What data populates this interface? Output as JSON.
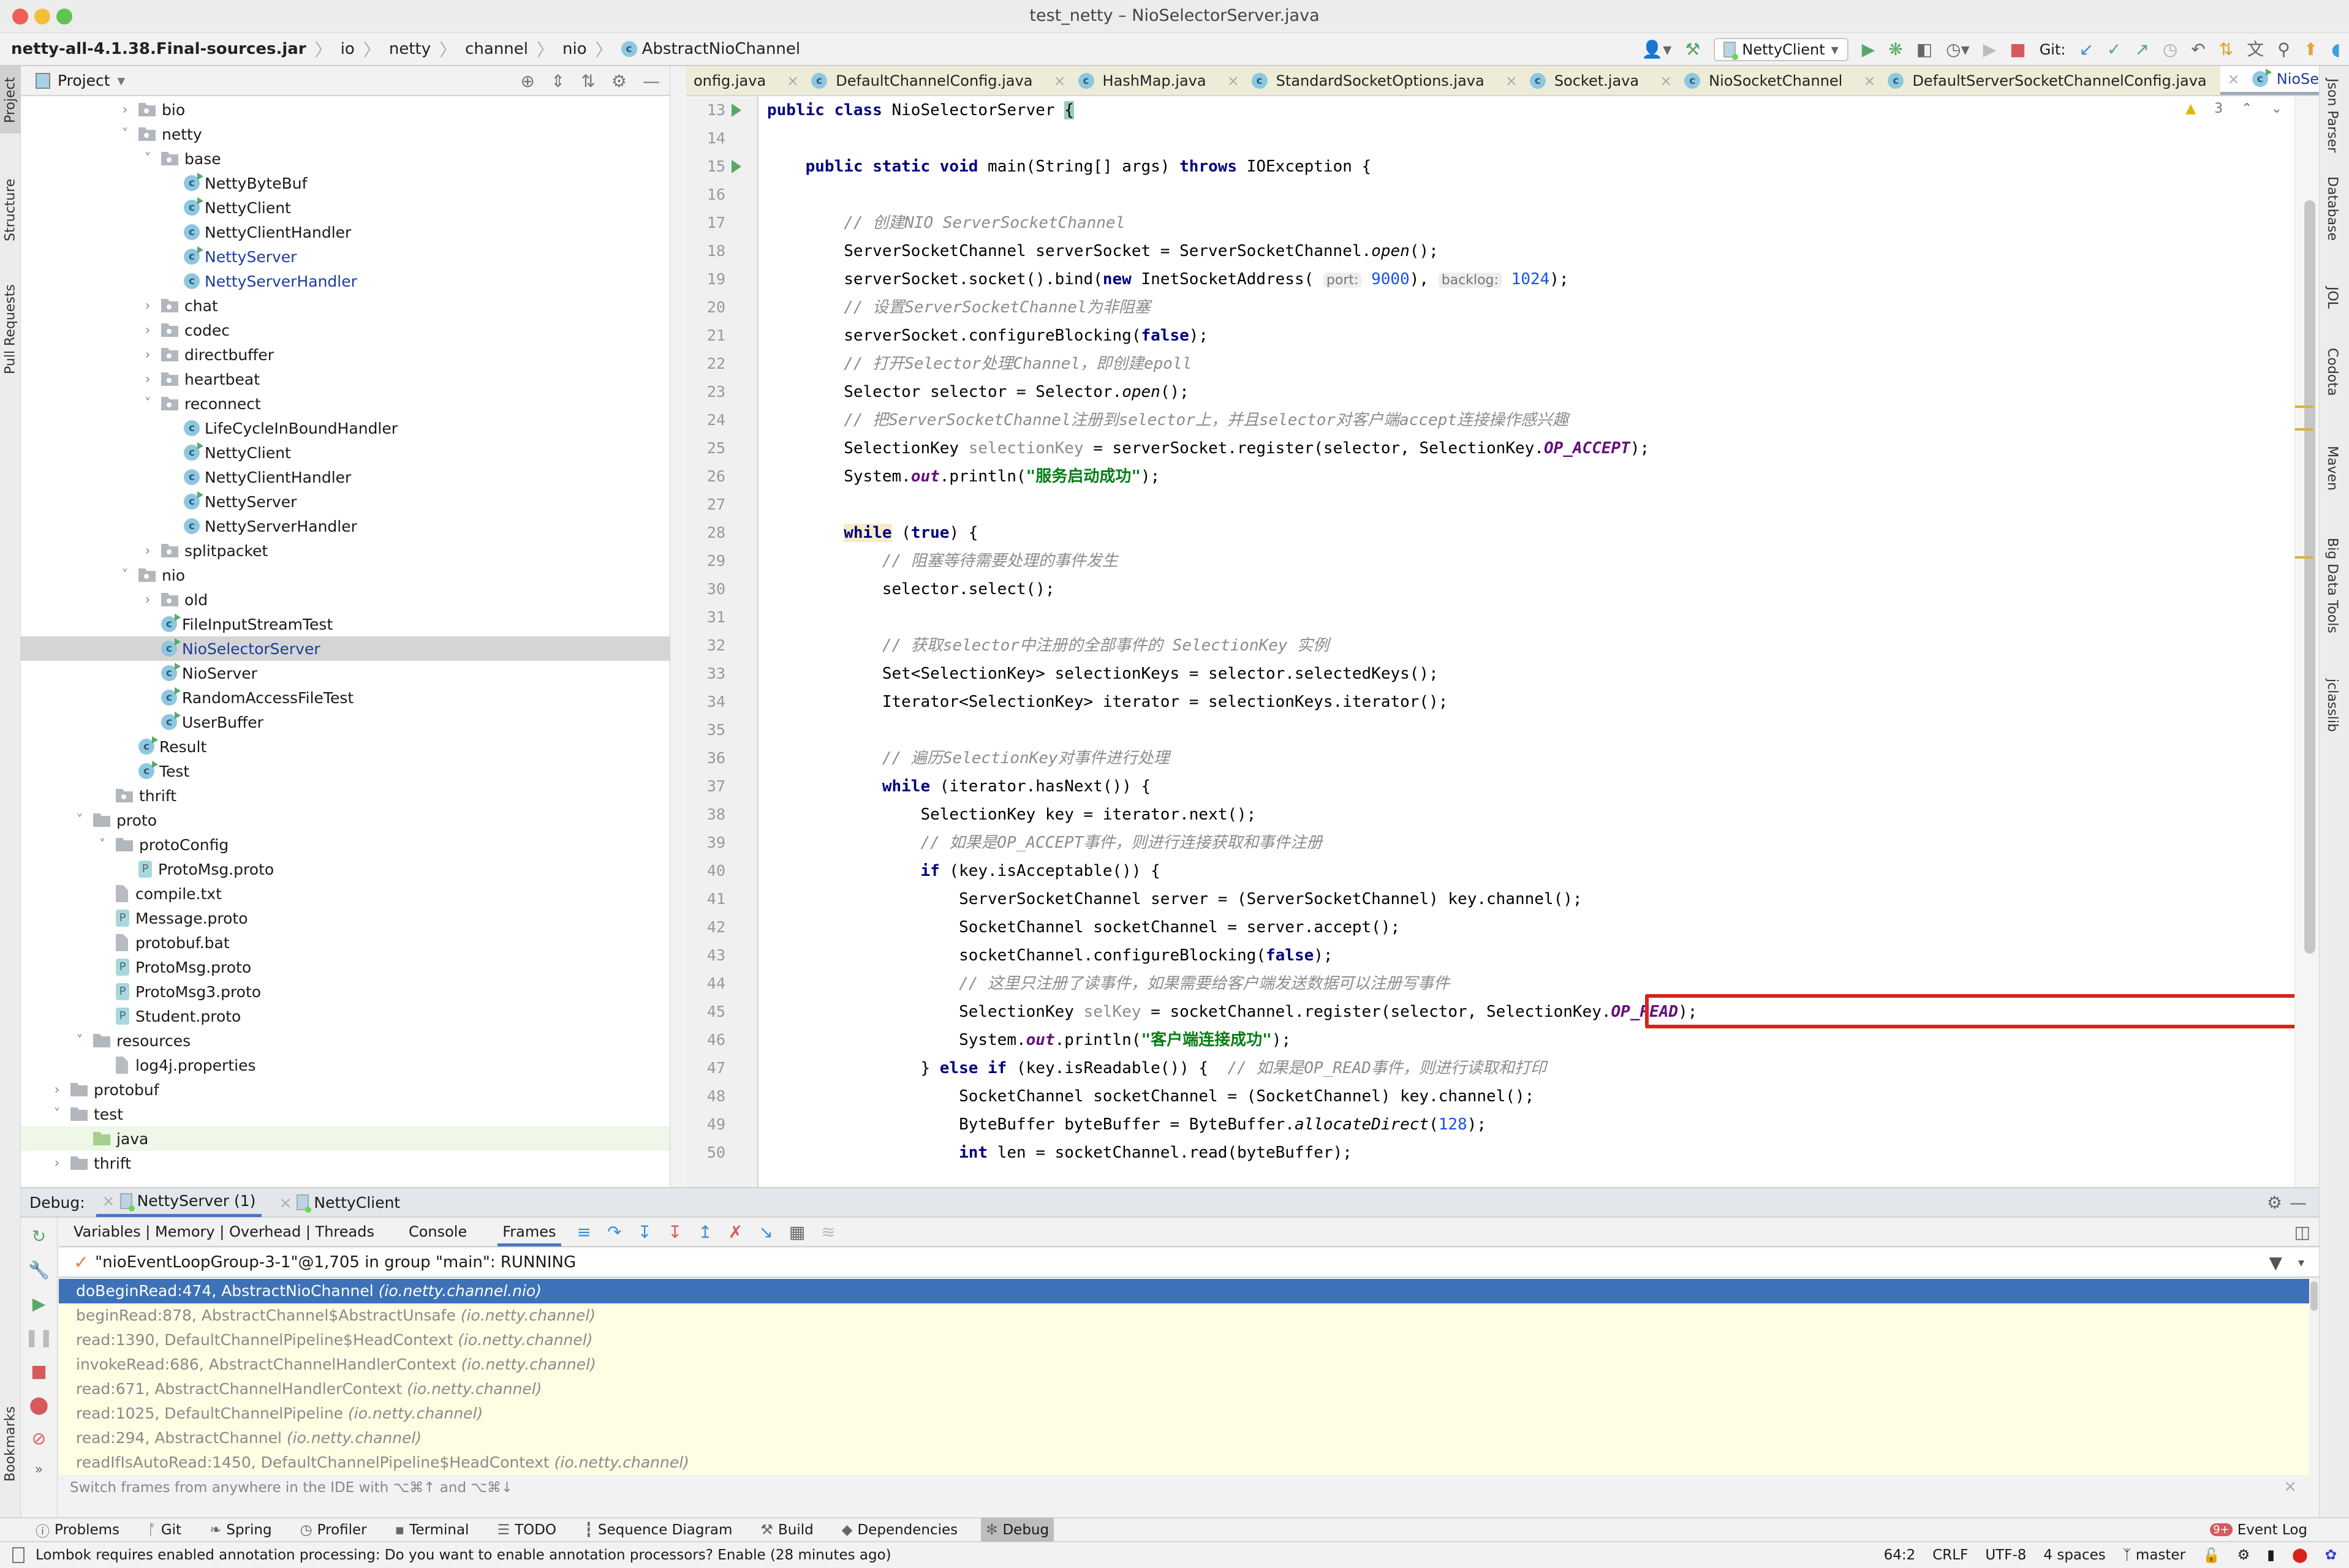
{
  "window": {
    "title": "test_netty – NioSelectorServer.java"
  },
  "breadcrumb": {
    "root": "netty-all-4.1.38.Final-sources.jar",
    "parts": [
      "io",
      "netty",
      "channel",
      "nio"
    ],
    "current": "AbstractNioChannel"
  },
  "toolbar": {
    "run_config": "NettyClient",
    "git_label": "Git:"
  },
  "project_panel": {
    "title": "Project",
    "tree": [
      {
        "label": "bio",
        "type": "package",
        "indent": 4,
        "expanded": false
      },
      {
        "label": "netty",
        "type": "package",
        "indent": 4,
        "expanded": true
      },
      {
        "label": "base",
        "type": "package",
        "indent": 5,
        "expanded": true
      },
      {
        "label": "NettyByteBuf",
        "type": "class-run",
        "indent": 6
      },
      {
        "label": "NettyClient",
        "type": "class-run",
        "indent": 6
      },
      {
        "label": "NettyClientHandler",
        "type": "class",
        "indent": 6
      },
      {
        "label": "NettyServer",
        "type": "class-run",
        "indent": 6,
        "modified": true
      },
      {
        "label": "NettyServerHandler",
        "type": "class",
        "indent": 6,
        "modified": true
      },
      {
        "label": "chat",
        "type": "package",
        "indent": 5,
        "expanded": false
      },
      {
        "label": "codec",
        "type": "package",
        "indent": 5,
        "expanded": false
      },
      {
        "label": "directbuffer",
        "type": "package",
        "indent": 5,
        "expanded": false
      },
      {
        "label": "heartbeat",
        "type": "package",
        "indent": 5,
        "expanded": false
      },
      {
        "label": "reconnect",
        "type": "package",
        "indent": 5,
        "expanded": true
      },
      {
        "label": "LifeCycleInBoundHandler",
        "type": "class",
        "indent": 6
      },
      {
        "label": "NettyClient",
        "type": "class-run",
        "indent": 6
      },
      {
        "label": "NettyClientHandler",
        "type": "class",
        "indent": 6
      },
      {
        "label": "NettyServer",
        "type": "class-run",
        "indent": 6
      },
      {
        "label": "NettyServerHandler",
        "type": "class",
        "indent": 6
      },
      {
        "label": "splitpacket",
        "type": "package",
        "indent": 5,
        "expanded": false
      },
      {
        "label": "nio",
        "type": "package",
        "indent": 4,
        "expanded": true
      },
      {
        "label": "old",
        "type": "package",
        "indent": 5,
        "expanded": false
      },
      {
        "label": "FileInputStreamTest",
        "type": "class-run",
        "indent": 5
      },
      {
        "label": "NioSelectorServer",
        "type": "class-run",
        "indent": 5,
        "selected": true,
        "modified": true
      },
      {
        "label": "NioServer",
        "type": "class-run",
        "indent": 5
      },
      {
        "label": "RandomAccessFileTest",
        "type": "class-run",
        "indent": 5
      },
      {
        "label": "UserBuffer",
        "type": "class-run",
        "indent": 5
      },
      {
        "label": "Result",
        "type": "class-run",
        "indent": 4
      },
      {
        "label": "Test",
        "type": "class-run",
        "indent": 4
      },
      {
        "label": "thrift",
        "type": "package",
        "indent": 3
      },
      {
        "label": "proto",
        "type": "folder",
        "indent": 2,
        "expanded": true
      },
      {
        "label": "protoConfig",
        "type": "folder",
        "indent": 3,
        "expanded": true
      },
      {
        "label": "ProtoMsg.proto",
        "type": "proto",
        "indent": 4
      },
      {
        "label": "compile.txt",
        "type": "text",
        "indent": 3
      },
      {
        "label": "Message.proto",
        "type": "proto",
        "indent": 3
      },
      {
        "label": "protobuf.bat",
        "type": "text",
        "indent": 3
      },
      {
        "label": "ProtoMsg.proto",
        "type": "proto",
        "indent": 3
      },
      {
        "label": "ProtoMsg3.proto",
        "type": "proto",
        "indent": 3
      },
      {
        "label": "Student.proto",
        "type": "proto",
        "indent": 3
      },
      {
        "label": "resources",
        "type": "folder",
        "indent": 2,
        "expanded": true
      },
      {
        "label": "log4j.properties",
        "type": "text",
        "indent": 3
      },
      {
        "label": "protobuf",
        "type": "folder",
        "indent": 1,
        "expanded": false
      },
      {
        "label": "test",
        "type": "folder",
        "indent": 1,
        "expanded": true
      },
      {
        "label": "java",
        "type": "folder-green",
        "indent": 2,
        "highlight": true
      },
      {
        "label": "thrift",
        "type": "folder",
        "indent": 1,
        "expanded": false
      }
    ]
  },
  "editor_tabs": [
    {
      "label": "onfig.java"
    },
    {
      "label": "DefaultChannelConfig.java"
    },
    {
      "label": "HashMap.java"
    },
    {
      "label": "StandardSocketOptions.java"
    },
    {
      "label": "Socket.java"
    },
    {
      "label": "NioSocketChannel"
    },
    {
      "label": "DefaultServerSocketChannelConfig.java"
    },
    {
      "label": "NioSelectorServer.java",
      "active": true
    }
  ],
  "inspections": {
    "warnings": "3"
  },
  "code": {
    "lines": [
      13,
      14,
      15,
      16,
      17,
      18,
      19,
      20,
      21,
      22,
      23,
      24,
      25,
      26,
      27,
      28,
      29,
      30,
      31,
      32,
      33,
      34,
      35,
      36,
      37,
      38,
      39,
      40,
      41,
      42,
      43,
      44,
      45,
      46,
      47,
      48,
      49,
      50
    ],
    "hints": {
      "port_label": "port:",
      "port_value": "9000",
      "backlog_label": "backlog:",
      "backlog_value": "1024"
    },
    "comments": {
      "c17": "// 创建NIO ServerSocketChannel",
      "c20": "// 设置ServerSocketChannel为非阻塞",
      "c22": "// 打开Selector处理Channel，即创建epoll",
      "c24": "// 把ServerSocketChannel注册到selector上，并且selector对客户端accept连接操作感兴趣",
      "c29": "// 阻塞等待需要处理的事件发生",
      "c32": "// 获取selector中注册的全部事件的 SelectionKey 实例",
      "c36": "// 遍历SelectionKey对事件进行处理",
      "c39": "// 如果是OP_ACCEPT事件，则进行连接获取和事件注册",
      "c44": "// 这里只注册了读事件，如果需要给客户端发送数据可以注册写事件",
      "c47": "// 如果是OP_READ事件，则进行读取和打印"
    },
    "strings": {
      "s26": "\"服务启动成功\"",
      "s46": "\"客户端连接成功\""
    },
    "highlighted_line": 45
  },
  "debug": {
    "label": "Debug:",
    "sessions": [
      {
        "label": "NettyServer (1)",
        "active": true
      },
      {
        "label": "NettyClient"
      }
    ],
    "subtabs": {
      "variables": "Variables | Memory | Overhead | Threads",
      "console": "Console",
      "frames": "Frames"
    },
    "thread": "\"nioEventLoopGroup-3-1\"@1,705 in group \"main\": RUNNING",
    "frames": [
      {
        "method": "doBeginRead:474, AbstractNioChannel",
        "pkg": "(io.netty.channel.nio)",
        "selected": true
      },
      {
        "method": "beginRead:878, AbstractChannel$AbstractUnsafe",
        "pkg": "(io.netty.channel)"
      },
      {
        "method": "read:1390, DefaultChannelPipeline$HeadContext",
        "pkg": "(io.netty.channel)"
      },
      {
        "method": "invokeRead:686, AbstractChannelHandlerContext",
        "pkg": "(io.netty.channel)"
      },
      {
        "method": "read:671, AbstractChannelHandlerContext",
        "pkg": "(io.netty.channel)"
      },
      {
        "method": "read:1025, DefaultChannelPipeline",
        "pkg": "(io.netty.channel)"
      },
      {
        "method": "read:294, AbstractChannel",
        "pkg": "(io.netty.channel)"
      },
      {
        "method": "readIfIsAutoRead:1450, DefaultChannelPipeline$HeadContext",
        "pkg": "(io.netty.channel)"
      }
    ],
    "hint": "Switch frames from anywhere in the IDE with ⌥⌘↑ and ⌥⌘↓"
  },
  "left_stripe": [
    "Project",
    "Structure",
    "Pull Requests",
    "Bookmarks"
  ],
  "right_stripe": [
    "Json Parser",
    "Database",
    "JOL",
    "Codota",
    "Maven",
    "Big Data Tools",
    "jclasslib"
  ],
  "bottom_tools": [
    {
      "label": "Problems",
      "icon": "problems-icon"
    },
    {
      "label": "Git",
      "icon": "git-icon"
    },
    {
      "label": "Spring",
      "icon": "spring-icon"
    },
    {
      "label": "Profiler",
      "icon": "profiler-icon"
    },
    {
      "label": "Terminal",
      "icon": "terminal-icon"
    },
    {
      "label": "TODO",
      "icon": "todo-icon"
    },
    {
      "label": "Sequence Diagram",
      "icon": "sequence-diagram-icon"
    },
    {
      "label": "Build",
      "icon": "build-icon"
    },
    {
      "label": "Dependencies",
      "icon": "dependencies-icon"
    },
    {
      "label": "Debug",
      "icon": "debug-icon",
      "active": true
    }
  ],
  "event_log": {
    "label": "Event Log",
    "badge": "9+"
  },
  "status": {
    "message": "Lombok requires enabled annotation processing: Do you want to enable annotation processors? Enable (28 minutes ago)",
    "position": "64:2",
    "line_sep": "CRLF",
    "encoding": "UTF-8",
    "indent": "4 spaces",
    "branch": "master"
  }
}
